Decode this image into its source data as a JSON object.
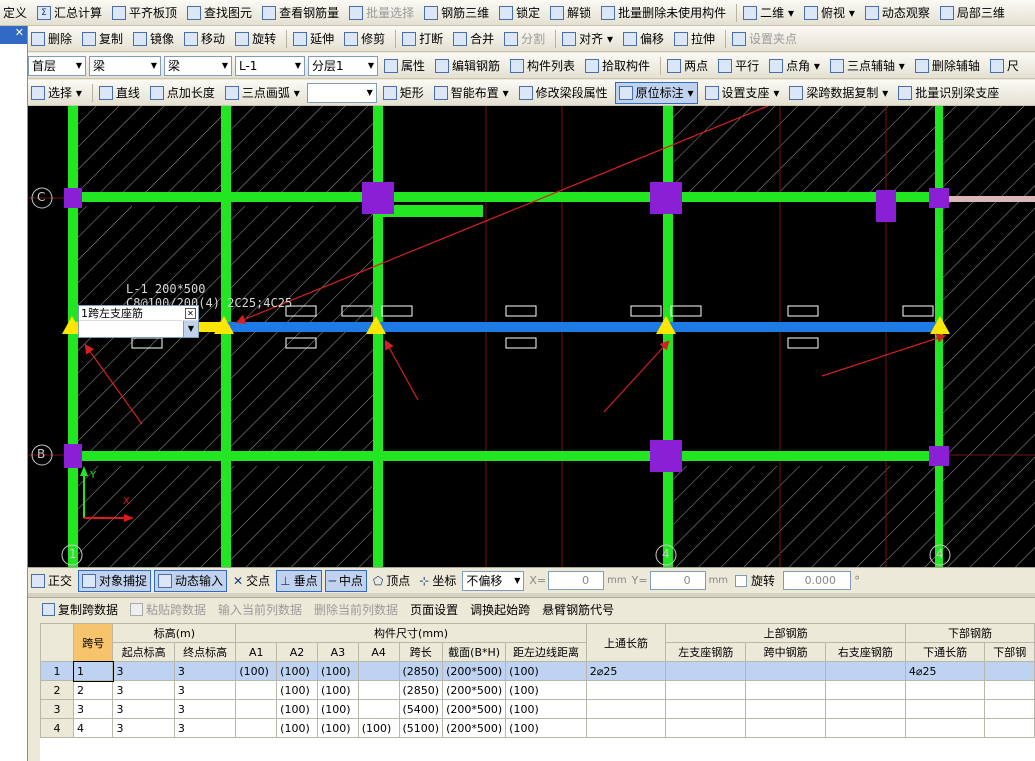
{
  "toolbar1": [
    "定义",
    "汇总计算",
    "平齐板顶",
    "查找图元",
    "查看钢筋量",
    "批量选择",
    "钢筋三维",
    "锁定",
    "解锁",
    "批量删除未使用构件",
    "二维",
    "俯视",
    "动态观察",
    "局部三维"
  ],
  "toolbar1_icons": [
    "",
    "Σ",
    "☰",
    "⌕",
    "⊕",
    "▦",
    "▥",
    "🔒",
    "🔓",
    "✎",
    "▭",
    "▣",
    "⟳",
    "◈"
  ],
  "toolbar2": [
    "删除",
    "复制",
    "镜像",
    "移动",
    "旋转",
    "延伸",
    "修剪",
    "打断",
    "合并",
    "分割",
    "对齐",
    "偏移",
    "拉伸",
    "设置夹点"
  ],
  "toolbar3": {
    "floor": "首层",
    "type1": "梁",
    "type2": "梁",
    "component": "L-1",
    "layer": "分层1",
    "buttons": [
      "属性",
      "编辑钢筋",
      "构件列表",
      "拾取构件",
      "两点",
      "平行",
      "点角",
      "三点辅轴",
      "删除辅轴",
      "尺"
    ]
  },
  "toolbar4": [
    "选择",
    "直线",
    "点加长度",
    "三点画弧",
    "",
    "矩形",
    "智能布置",
    "修改梁段属性",
    "原位标注",
    "设置支座",
    "梁跨数据复制",
    "批量识别梁支座"
  ],
  "left_panel": {
    "close_label": "✕"
  },
  "canvas": {
    "beam_name": "L-1 200*500",
    "beam_rebar": "C8@100/200(4) 2C25;4C25",
    "popup_title": "1跨左支座筋",
    "popup_close": "✕",
    "axis_labels": [
      "C",
      "B",
      "1",
      "4",
      "4"
    ],
    "coord_x": "X",
    "coord_y": "Y"
  },
  "snapbar": {
    "items": [
      "正交",
      "对象捕捉",
      "动态输入",
      "交点",
      "垂点",
      "中点",
      "顶点",
      "坐标"
    ],
    "offset": "不偏移",
    "x_label": "X=",
    "x_value": "0",
    "unit1": "mm",
    "y_label": "Y=",
    "y_value": "0",
    "unit2": "mm",
    "rotate_label": "旋转",
    "rotate_value": "0.000",
    "degree": "°"
  },
  "grid_toolbar": [
    "复制跨数据",
    "粘贴跨数据",
    "输入当前列数据",
    "删除当前列数据",
    "页面设置",
    "调换起始跨",
    "悬臂钢筋代号"
  ],
  "table": {
    "group_headers": {
      "span": "跨号",
      "elevation": "标高(m)",
      "size": "构件尺寸(mm)",
      "top_through": "上通长筋",
      "top_rebar": "上部钢筋",
      "bottom_rebar": "下部钢筋"
    },
    "sub_headers": [
      "起点标高",
      "终点标高",
      "A1",
      "A2",
      "A3",
      "A4",
      "跨长",
      "截面(B*H)",
      "距左边线距离"
    ],
    "top_sub": [
      "左支座钢筋",
      "跨中钢筋",
      "右支座钢筋"
    ],
    "bottom_sub": [
      "下通长筋",
      "下部钢"
    ],
    "rows": [
      {
        "rn": "1",
        "span": "1",
        "start": "3",
        "end": "3",
        "a1": "(100)",
        "a2": "(100)",
        "a3": "(100)",
        "a4": "",
        "len": "(2850)",
        "sec": "(200*500)",
        "dist": "(100)",
        "top": "2⌀25",
        "left": "",
        "mid": "",
        "right": "",
        "bot": "4⌀25",
        "bot2": ""
      },
      {
        "rn": "2",
        "span": "2",
        "start": "3",
        "end": "3",
        "a1": "",
        "a2": "(100)",
        "a3": "(100)",
        "a4": "",
        "len": "(2850)",
        "sec": "(200*500)",
        "dist": "(100)",
        "top": "",
        "left": "",
        "mid": "",
        "right": "",
        "bot": "",
        "bot2": ""
      },
      {
        "rn": "3",
        "span": "3",
        "start": "3",
        "end": "3",
        "a1": "",
        "a2": "(100)",
        "a3": "(100)",
        "a4": "",
        "len": "(5400)",
        "sec": "(200*500)",
        "dist": "(100)",
        "top": "",
        "left": "",
        "mid": "",
        "right": "",
        "bot": "",
        "bot2": ""
      },
      {
        "rn": "4",
        "span": "4",
        "start": "3",
        "end": "3",
        "a1": "",
        "a2": "(100)",
        "a3": "(100)",
        "a4": "(100)",
        "len": "(5100)",
        "sec": "(200*500)",
        "dist": "(100)",
        "top": "",
        "left": "",
        "mid": "",
        "right": "",
        "bot": "",
        "bot2": ""
      }
    ]
  },
  "colors": {
    "beam_green": "#22e622",
    "beam_blue": "#1e7be6",
    "column_purple": "#8a1fd6",
    "support_yellow": "#ffe600",
    "annot_red": "#d42020"
  }
}
